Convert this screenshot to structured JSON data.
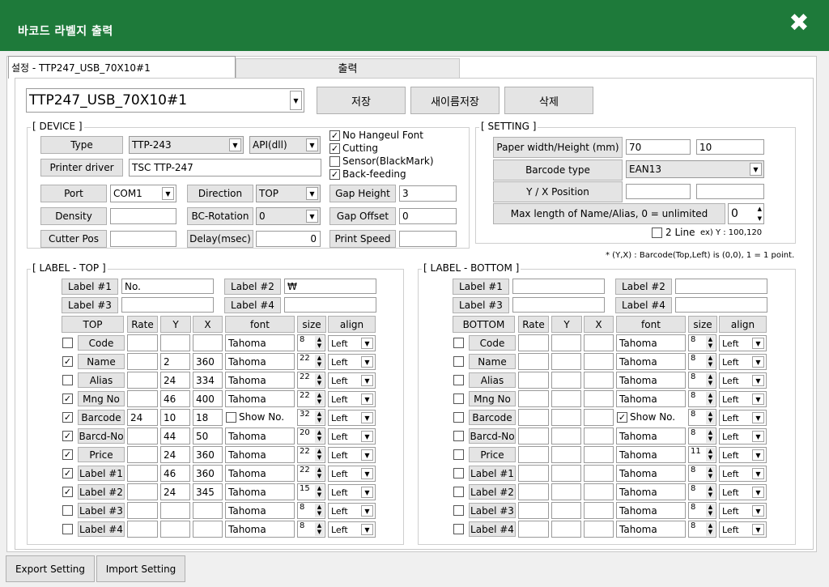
{
  "window": {
    "title": "바코드 라벨지 출력",
    "close_label": "✖"
  },
  "tabs": [
    {
      "label": "설정 - TTP247_USB_70X10#1"
    },
    {
      "label": "출력"
    }
  ],
  "profile": {
    "value": "TTP247_USB_70X10#1"
  },
  "actions": {
    "save": "저장",
    "save_as": "새이름저장",
    "delete": "삭제"
  },
  "device": {
    "title": "[ DEVICE ]",
    "type_label": "Type",
    "type_value": "TTP-243",
    "api_value": "API(dll)",
    "driver_label": "Printer driver",
    "driver_value": "TSC TTP-247",
    "port_label": "Port",
    "port_value": "COM1",
    "direction_label": "Direction",
    "direction_value": "TOP",
    "density_label": "Density",
    "density_value": "",
    "bc_rotation_label": "BC-Rotation",
    "bc_rotation_value": "0",
    "cutter_label": "Cutter Pos",
    "cutter_value": "",
    "delay_label": "Delay(msec)",
    "delay_value": "0",
    "gap_height_label": "Gap Height",
    "gap_height_value": "3",
    "gap_offset_label": "Gap Offset",
    "gap_offset_value": "0",
    "print_speed_label": "Print Speed",
    "print_speed_value": "",
    "options": [
      {
        "label": "No Hangeul Font",
        "checked": true
      },
      {
        "label": "Cutting",
        "checked": true
      },
      {
        "label": "Sensor(BlackMark)",
        "checked": false
      },
      {
        "label": "Back-feeding",
        "checked": true
      }
    ]
  },
  "setting": {
    "title": "[ SETTING ]",
    "paper_label": "Paper width/Height (mm)",
    "paper_w": "70",
    "paper_h": "10",
    "barcode_type_label": "Barcode type",
    "barcode_type_value": "EAN13",
    "pos_label": "Y / X Position",
    "pos_y": "",
    "pos_x": "",
    "maxlen_label": "Max length of Name/Alias, 0 = unlimited",
    "maxlen_value": "0",
    "two_line_label": "2 Line",
    "two_line_checked": false,
    "example": "ex) Y : 100,120",
    "footnote": "* (Y,X) : Barcode(Top,Left) is (0,0),   1 = 1 point."
  },
  "label_top": {
    "title": "[ LABEL - TOP ]",
    "label1": "Label #1",
    "label1_value": "No.",
    "label2": "Label #2",
    "label2_value": "₩",
    "label3": "Label #3",
    "label3_value": "",
    "label4": "Label #4",
    "label4_value": "",
    "headers": [
      "TOP",
      "Rate",
      "Y",
      "X",
      "font",
      "size",
      "align"
    ],
    "rows": [
      {
        "checked": false,
        "name": "Code",
        "rate": "",
        "y": "",
        "x": "",
        "font": "Tahoma",
        "size": "8",
        "align": "Left"
      },
      {
        "checked": true,
        "name": "Name",
        "rate": "",
        "y": "2",
        "x": "360",
        "font": "Tahoma",
        "size": "22",
        "align": "Left"
      },
      {
        "checked": false,
        "name": "Alias",
        "rate": "",
        "y": "24",
        "x": "334",
        "font": "Tahoma",
        "size": "22",
        "align": "Left"
      },
      {
        "checked": true,
        "name": "Mng No",
        "rate": "",
        "y": "46",
        "x": "400",
        "font": "Tahoma",
        "size": "22",
        "align": "Left"
      },
      {
        "checked": true,
        "name": "Barcode",
        "rate": "24",
        "y": "10",
        "x": "18",
        "font": "Show No.",
        "show_no": true,
        "show_no_checked": false,
        "size": "32",
        "align": "Left"
      },
      {
        "checked": true,
        "name": "Barcd-No",
        "rate": "",
        "y": "44",
        "x": "50",
        "font": "Tahoma",
        "size": "20",
        "align": "Left"
      },
      {
        "checked": true,
        "name": "Price",
        "rate": "",
        "y": "24",
        "x": "360",
        "font": "Tahoma",
        "size": "22",
        "align": "Left"
      },
      {
        "checked": true,
        "name": "Label #1",
        "rate": "",
        "y": "46",
        "x": "360",
        "font": "Tahoma",
        "size": "22",
        "align": "Left"
      },
      {
        "checked": true,
        "name": "Label #2",
        "rate": "",
        "y": "24",
        "x": "345",
        "font": "Tahoma",
        "size": "15",
        "align": "Left"
      },
      {
        "checked": false,
        "name": "Label #3",
        "rate": "",
        "y": "",
        "x": "",
        "font": "Tahoma",
        "size": "8",
        "align": "Left"
      },
      {
        "checked": false,
        "name": "Label #4",
        "rate": "",
        "y": "",
        "x": "",
        "font": "Tahoma",
        "size": "8",
        "align": "Left"
      }
    ]
  },
  "label_bottom": {
    "title": "[ LABEL - BOTTOM ]",
    "label1": "Label #1",
    "label1_value": "",
    "label2": "Label #2",
    "label2_value": "",
    "label3": "Label #3",
    "label3_value": "",
    "label4": "Label #4",
    "label4_value": "",
    "headers": [
      "BOTTOM",
      "Rate",
      "Y",
      "X",
      "font",
      "size",
      "align"
    ],
    "rows": [
      {
        "checked": false,
        "name": "Code",
        "rate": "",
        "y": "",
        "x": "",
        "font": "Tahoma",
        "size": "8",
        "align": "Left"
      },
      {
        "checked": false,
        "name": "Name",
        "rate": "",
        "y": "",
        "x": "",
        "font": "Tahoma",
        "size": "8",
        "align": "Left"
      },
      {
        "checked": false,
        "name": "Alias",
        "rate": "",
        "y": "",
        "x": "",
        "font": "Tahoma",
        "size": "8",
        "align": "Left"
      },
      {
        "checked": false,
        "name": "Mng No",
        "rate": "",
        "y": "",
        "x": "",
        "font": "Tahoma",
        "size": "8",
        "align": "Left"
      },
      {
        "checked": false,
        "name": "Barcode",
        "rate": "",
        "y": "",
        "x": "",
        "font": "Show No.",
        "show_no": true,
        "show_no_checked": true,
        "size": "8",
        "align": "Left"
      },
      {
        "checked": false,
        "name": "Barcd-No",
        "rate": "",
        "y": "",
        "x": "",
        "font": "Tahoma",
        "size": "8",
        "align": "Left"
      },
      {
        "checked": false,
        "name": "Price",
        "rate": "",
        "y": "",
        "x": "",
        "font": "Tahoma",
        "size": "11",
        "align": "Left"
      },
      {
        "checked": false,
        "name": "Label #1",
        "rate": "",
        "y": "",
        "x": "",
        "font": "Tahoma",
        "size": "8",
        "align": "Left"
      },
      {
        "checked": false,
        "name": "Label #2",
        "rate": "",
        "y": "",
        "x": "",
        "font": "Tahoma",
        "size": "8",
        "align": "Left"
      },
      {
        "checked": false,
        "name": "Label #3",
        "rate": "",
        "y": "",
        "x": "",
        "font": "Tahoma",
        "size": "8",
        "align": "Left"
      },
      {
        "checked": false,
        "name": "Label #4",
        "rate": "",
        "y": "",
        "x": "",
        "font": "Tahoma",
        "size": "8",
        "align": "Left"
      }
    ]
  },
  "footer": {
    "export": "Export Setting",
    "import": "Import Setting"
  },
  "colors": {
    "titlebar": "#1e7a3a"
  }
}
